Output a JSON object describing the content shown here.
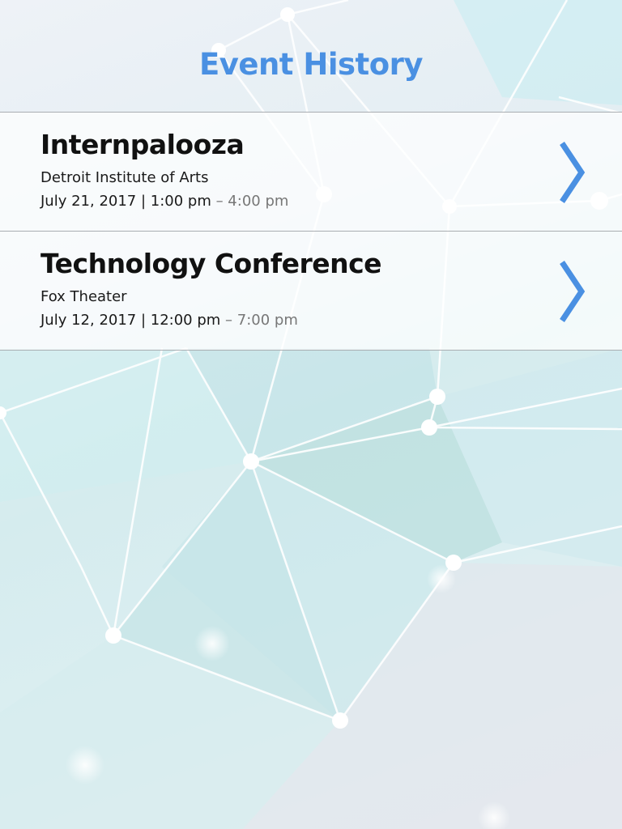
{
  "page": {
    "title": "Event History"
  },
  "colors": {
    "accent": "#4a90e2",
    "text": "#111111",
    "muted": "#777777",
    "divider": "#a9adb1"
  },
  "events": [
    {
      "title": "Internpalooza",
      "venue": "Detroit Institute of Arts",
      "start": "July 21, 2017 | 1:00 pm",
      "end": " – 4:00 pm",
      "icon": "chevron-right-icon"
    },
    {
      "title": "Technology Conference",
      "venue": "Fox Theater",
      "start": "July 12, 2017 | 12:00 pm",
      "end": " – 7:00 pm",
      "icon": "chevron-right-icon"
    }
  ]
}
